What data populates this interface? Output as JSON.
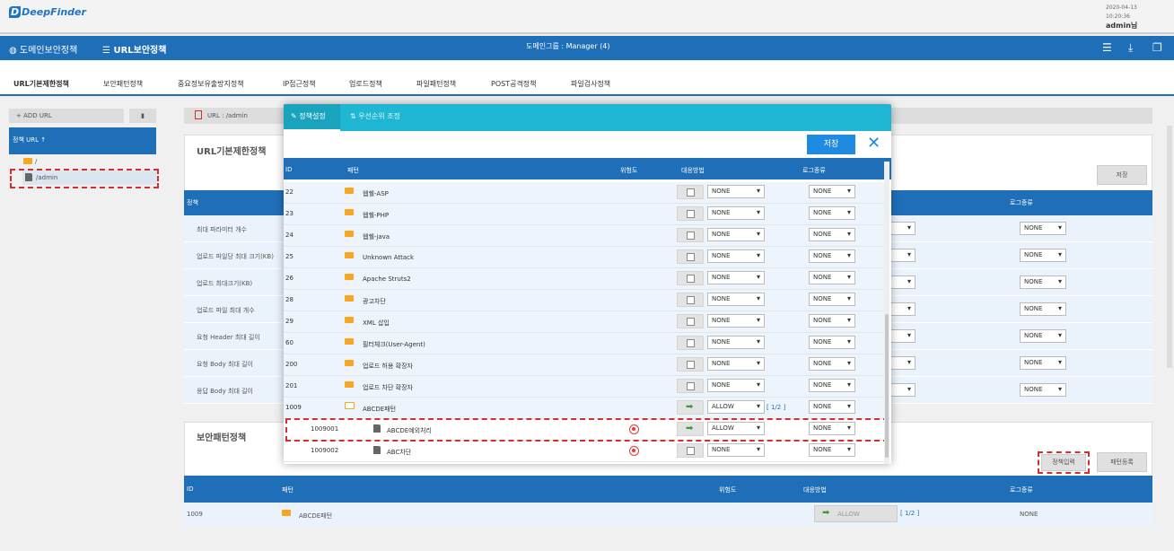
{
  "app": {
    "logo": "DeepFinder",
    "date": "2020-04-13",
    "time": "10:20:36",
    "user": "admin님"
  },
  "navbar": {
    "domain_policy": "도메인보안정책",
    "url_policy": "URL보안정책",
    "center": "도메인그룹 : Manager (4)"
  },
  "subtabs": [
    "URL기본제한정책",
    "보안패턴정책",
    "중요정보유출방지정책",
    "IP접근정책",
    "업로드정책",
    "파일패턴정책",
    "POST공격정책",
    "파일검사정책"
  ],
  "sidebar": {
    "add_url": "+ ADD URL",
    "header": "정책 URL",
    "tree": [
      "/",
      "/admin"
    ]
  },
  "main": {
    "url_bar": "URL : /admin",
    "section1_title": "URL기본제한정책",
    "save": "저장",
    "col_policy": "정책",
    "col_log": "로그종류",
    "policy_rows": [
      "최대 파라미터 개수",
      "업로드 파일당 최대 크기(KB)",
      "업로드 최대크기(KB)",
      "업로드 파일 최대 개수",
      "요청 Header 최대 길이",
      "요청 Body 최대 길이",
      "응답 Body 최대 길이"
    ],
    "section2_title": "보안패턴정책",
    "input_btn": "정책입력",
    "register_btn": "패턴등록",
    "bottom_header": {
      "id": "ID",
      "pattern": "패턴",
      "risk": "위험도",
      "response": "대응방법",
      "log": "로그종류"
    },
    "bottom_row": {
      "id": "1009",
      "name": "ABCDE패턴",
      "action": "ALLOW",
      "page": "[ 1/2 ]",
      "log": "NONE"
    }
  },
  "modal": {
    "tab1": "정책설정",
    "tab2": "우선순위 조정",
    "save": "저장",
    "headers": {
      "id": "ID",
      "pattern": "패턴",
      "risk": "위험도",
      "response": "대응방법",
      "log": "로그종류"
    },
    "rows": [
      {
        "id": "22",
        "name": "웹쉘-ASP",
        "action": "NONE",
        "log": "NONE"
      },
      {
        "id": "23",
        "name": "웹쉘-PHP",
        "action": "NONE",
        "log": "NONE"
      },
      {
        "id": "24",
        "name": "웹쉘-java",
        "action": "NONE",
        "log": "NONE"
      },
      {
        "id": "25",
        "name": "Unknown Attack",
        "action": "NONE",
        "log": "NONE"
      },
      {
        "id": "26",
        "name": "Apache Struts2",
        "action": "NONE",
        "log": "NONE"
      },
      {
        "id": "28",
        "name": "광고차단",
        "action": "NONE",
        "log": "NONE"
      },
      {
        "id": "29",
        "name": "XML 삽입",
        "action": "NONE",
        "log": "NONE"
      },
      {
        "id": "60",
        "name": "필터체크(User-Agent)",
        "action": "NONE",
        "log": "NONE"
      },
      {
        "id": "200",
        "name": "업로드 허용 확장자",
        "action": "NONE",
        "log": "NONE"
      },
      {
        "id": "201",
        "name": "업로드 차단 확장자",
        "action": "NONE",
        "log": "NONE"
      },
      {
        "id": "1009",
        "name": "ABCDE패턴",
        "action": "ALLOW",
        "page": "[ 1/2 ]",
        "log": "NONE"
      },
      {
        "id": "1009001",
        "name": "ABCDE예외처리",
        "action": "ALLOW",
        "log": "NONE"
      },
      {
        "id": "1009002",
        "name": "ABC차단",
        "action": "NONE",
        "log": "NONE"
      }
    ]
  }
}
